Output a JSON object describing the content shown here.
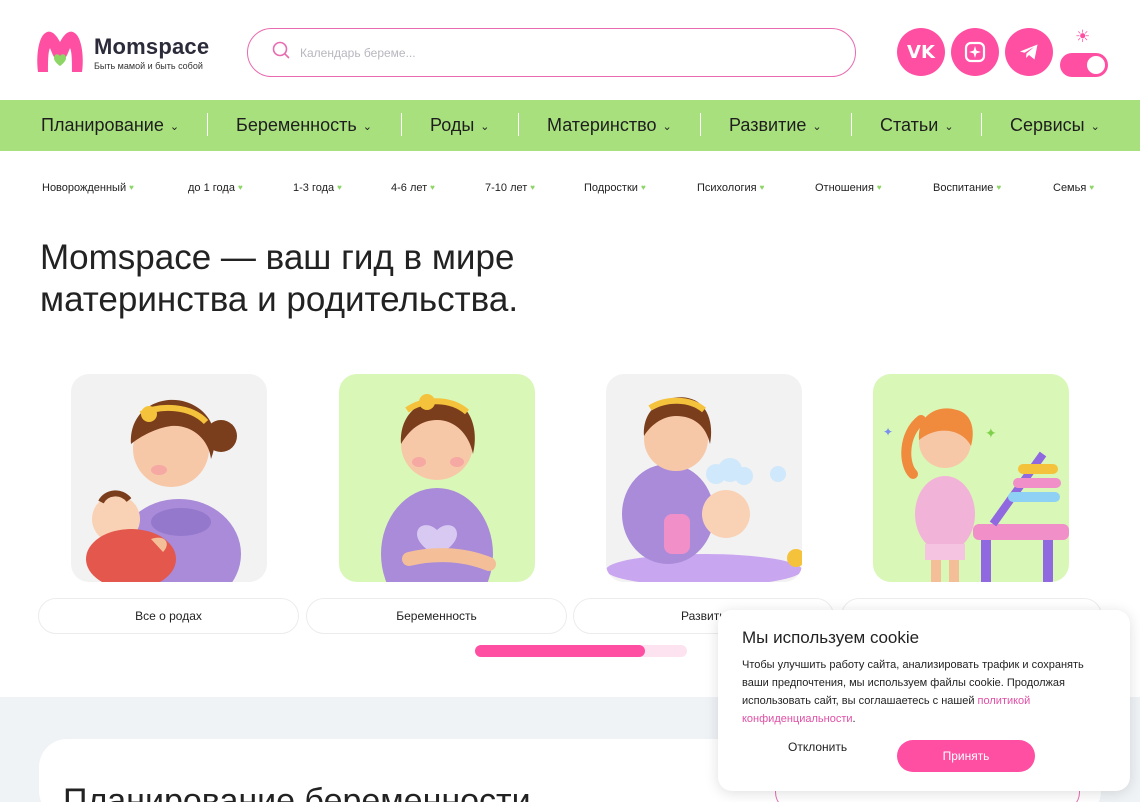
{
  "header": {
    "logo_title": "Momspace",
    "logo_subtitle": "Быть мамой и быть собой",
    "search_placeholder": "Календарь береме...",
    "social": [
      {
        "name": "vk",
        "label": "VK"
      },
      {
        "name": "square-app-icon"
      },
      {
        "name": "telegram-icon"
      }
    ],
    "theme_icon": "sun-icon"
  },
  "main_nav": [
    {
      "label": "Планирование"
    },
    {
      "label": "Беременность"
    },
    {
      "label": "Роды"
    },
    {
      "label": "Материнство"
    },
    {
      "label": "Развитие"
    },
    {
      "label": "Статьи"
    },
    {
      "label": "Сервисы"
    }
  ],
  "sub_nav": [
    {
      "label": "Новорожденный"
    },
    {
      "label": "до 1 года"
    },
    {
      "label": "1-3 года"
    },
    {
      "label": "4-6 лет"
    },
    {
      "label": "7-10 лет"
    },
    {
      "label": "Подростки"
    },
    {
      "label": "Психология"
    },
    {
      "label": "Отношения"
    },
    {
      "label": "Воспитание"
    },
    {
      "label": "Семья"
    }
  ],
  "hero": {
    "title_line1": "Momspace — ваш гид в мире",
    "title_line2": "материнства и родительства."
  },
  "cards": [
    {
      "label": "Все о родах",
      "bg": "#f2f2f2"
    },
    {
      "label": "Беременность",
      "bg": "#d9f7b7"
    },
    {
      "label": "Развити",
      "bg": "#f2f2f2"
    },
    {
      "label": "",
      "bg": "#d9f7b7"
    }
  ],
  "carousel": {
    "progress": 0.8
  },
  "section": {
    "title": "Планирование беременности"
  },
  "cookie": {
    "title": "Мы используем cookie",
    "text": "Чтобы улучшить работу сайта, анализировать трафик и сохранять ваши предпочтения, мы используем файлы cookie. Продолжая использовать сайт, вы соглашаетесь с нашей ",
    "link": "политикой конфиденциальности",
    "text_end": ".",
    "decline": "Отклонить",
    "accept": "Принять"
  },
  "colors": {
    "accent": "#ff4fa3",
    "nav_green": "#a8e07e",
    "card_green": "#d9f7b7"
  }
}
